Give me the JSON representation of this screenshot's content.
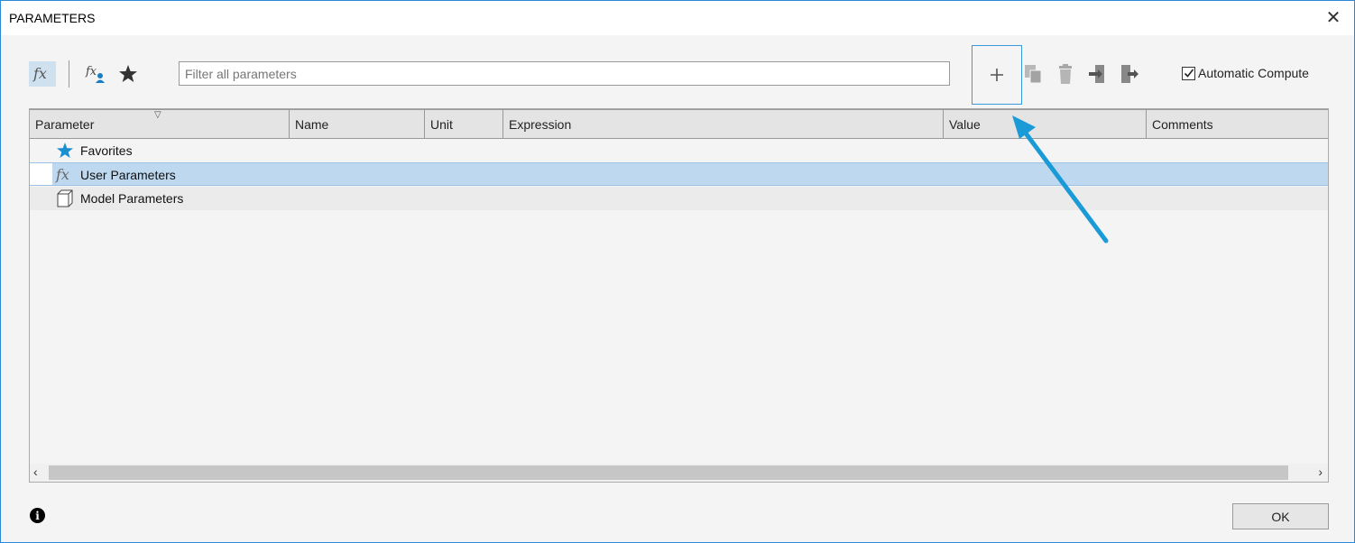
{
  "window": {
    "title": "PARAMETERS",
    "close_glyph": "✕"
  },
  "toolbar": {
    "fx_icon": "fx-icon",
    "user_fx_icon": "user-parameter-icon",
    "favorites_icon": "star-icon",
    "filter_placeholder": "Filter all parameters",
    "add_glyph": "+",
    "tools": [
      "copy-icon",
      "delete-icon",
      "import-icon",
      "export-icon"
    ],
    "auto_compute_label": "Automatic Compute",
    "auto_compute_checked": true
  },
  "table": {
    "columns": [
      "Parameter",
      "Name",
      "Unit",
      "Expression",
      "Value",
      "Comments"
    ],
    "rows": [
      {
        "label": "Favorites",
        "icon": "star-icon",
        "selected": false
      },
      {
        "label": "User Parameters",
        "icon": "fx-icon",
        "selected": true
      },
      {
        "label": "Model Parameters",
        "icon": "box-icon",
        "selected": false
      }
    ]
  },
  "footer": {
    "info_glyph": "i",
    "ok_label": "OK"
  },
  "colors": {
    "accent": "#1a9ad6",
    "selected_row": "#bed8ef"
  }
}
